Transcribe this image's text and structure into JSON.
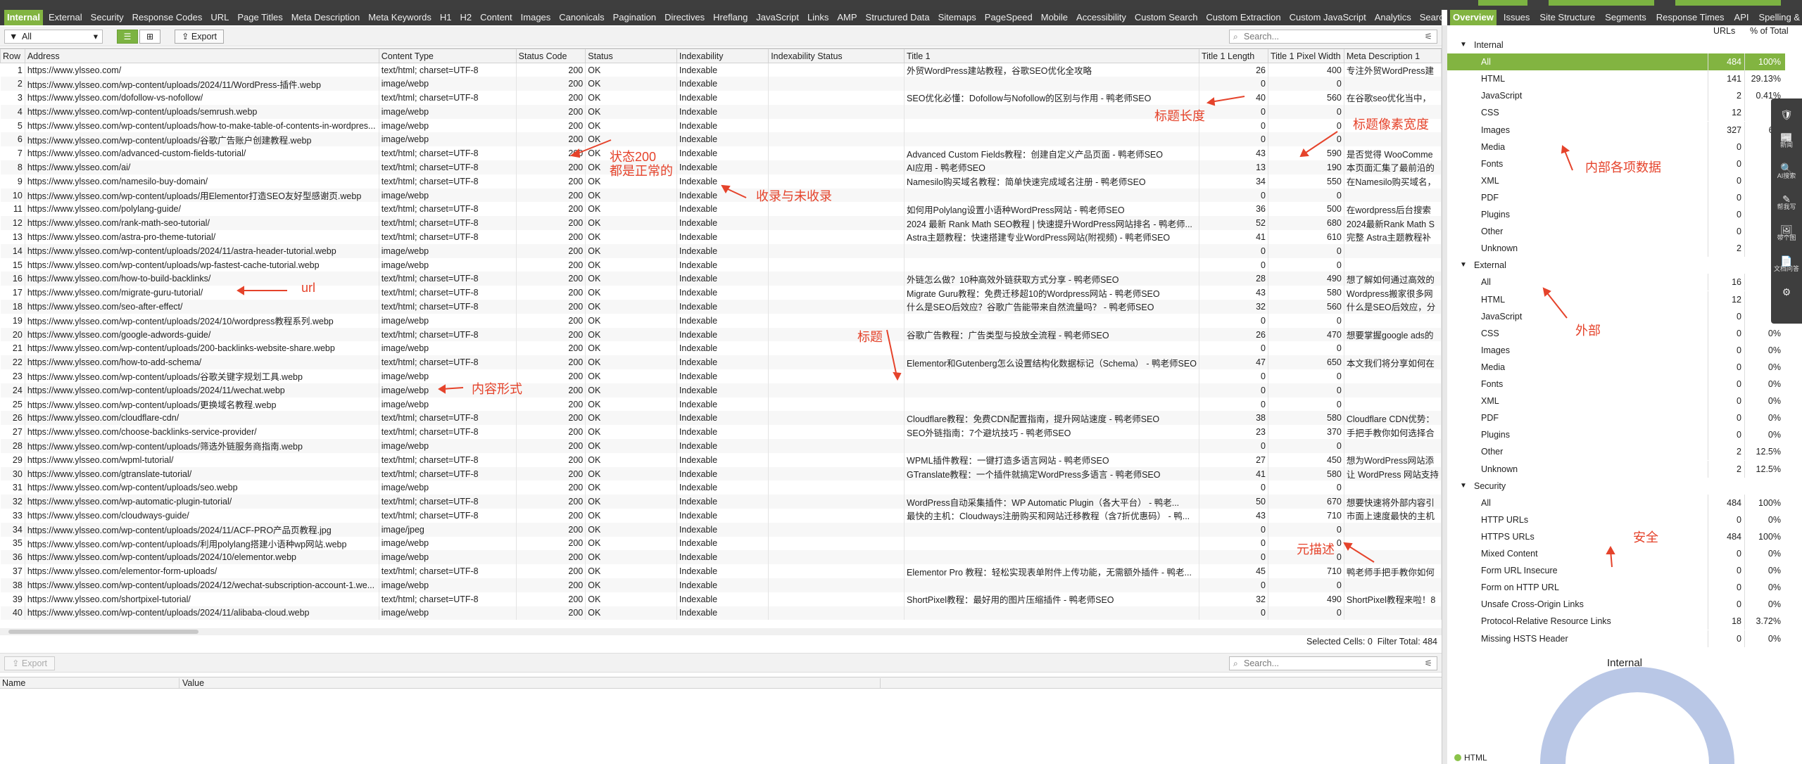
{
  "app": {
    "accent": "#82b441",
    "title": "Screaming Frog SEO Spider"
  },
  "tabs": [
    "Internal",
    "External",
    "Security",
    "Response Codes",
    "URL",
    "Page Titles",
    "Meta Description",
    "Meta Keywords",
    "H1",
    "H2",
    "Content",
    "Images",
    "Canonicals",
    "Pagination",
    "Directives",
    "Hreflang",
    "JavaScript",
    "Links",
    "AMP",
    "Structured Data",
    "Sitemaps",
    "PageSpeed",
    "Mobile",
    "Accessibility",
    "Custom Search",
    "Custom Extraction",
    "Custom JavaScript",
    "Analytics",
    "Search Console",
    "V"
  ],
  "right_tabs": [
    "Overview",
    "Issues",
    "Site Structure",
    "Segments",
    "Response Times",
    "API",
    "Spelling & G"
  ],
  "toolbar": {
    "filter_value": "All",
    "export_label": "Export",
    "search_placeholder": "Search..."
  },
  "columns": [
    "Row",
    "Address",
    "Content Type",
    "Status Code",
    "Status",
    "Indexability",
    "Indexability Status",
    "Title 1",
    "Title 1 Length",
    "Title 1 Pixel Width",
    "Meta Description 1"
  ],
  "rows": [
    [
      "1",
      "https://www.ylsseo.com/",
      "text/html; charset=UTF-8",
      "200",
      "OK",
      "Indexable",
      "",
      "外贸WordPress建站教程，谷歌SEO优化全攻略",
      "26",
      "400",
      "专注外贸WordPress建"
    ],
    [
      "2",
      "https://www.ylsseo.com/wp-content/uploads/2024/11/WordPress-插件.webp",
      "image/webp",
      "200",
      "OK",
      "Indexable",
      "",
      "",
      "0",
      "0",
      ""
    ],
    [
      "3",
      "https://www.ylsseo.com/dofollow-vs-nofollow/",
      "text/html; charset=UTF-8",
      "200",
      "OK",
      "Indexable",
      "",
      "SEO优化必懂：Dofollow与Nofollow的区别与作用 - 鸭老师SEO",
      "40",
      "560",
      "在谷歌seo优化当中，"
    ],
    [
      "4",
      "https://www.ylsseo.com/wp-content/uploads/semrush.webp",
      "image/webp",
      "200",
      "OK",
      "Indexable",
      "",
      "",
      "0",
      "0",
      ""
    ],
    [
      "5",
      "https://www.ylsseo.com/wp-content/uploads/how-to-make-table-of-contents-in-wordpres...",
      "image/webp",
      "200",
      "OK",
      "Indexable",
      "",
      "",
      "0",
      "0",
      ""
    ],
    [
      "6",
      "https://www.ylsseo.com/wp-content/uploads/谷歌广告账户创建教程.webp",
      "image/webp",
      "200",
      "OK",
      "Indexable",
      "",
      "",
      "0",
      "0",
      ""
    ],
    [
      "7",
      "https://www.ylsseo.com/advanced-custom-fields-tutorial/",
      "text/html; charset=UTF-8",
      "200",
      "OK",
      "Indexable",
      "",
      "Advanced Custom Fields教程：创建自定义产品页面 - 鸭老师SEO",
      "43",
      "590",
      "是否觉得 WooComme"
    ],
    [
      "8",
      "https://www.ylsseo.com/ai/",
      "text/html; charset=UTF-8",
      "200",
      "OK",
      "Indexable",
      "",
      "AI应用 - 鸭老师SEO",
      "13",
      "190",
      "本页面汇集了最前沿的"
    ],
    [
      "9",
      "https://www.ylsseo.com/namesilo-buy-domain/",
      "text/html; charset=UTF-8",
      "200",
      "OK",
      "Indexable",
      "",
      "Namesilo购买域名教程：简单快速完成域名注册 - 鸭老师SEO",
      "34",
      "550",
      "在Namesilo购买域名，"
    ],
    [
      "10",
      "https://www.ylsseo.com/wp-content/uploads/用Elementor打造SEO友好型感谢页.webp",
      "image/webp",
      "200",
      "OK",
      "Indexable",
      "",
      "",
      "0",
      "0",
      ""
    ],
    [
      "11",
      "https://www.ylsseo.com/polylang-guide/",
      "text/html; charset=UTF-8",
      "200",
      "OK",
      "Indexable",
      "",
      "如何用Polylang设置小语种WordPress网站 - 鸭老师SEO",
      "36",
      "500",
      "在wordpress后台搜索"
    ],
    [
      "12",
      "https://www.ylsseo.com/rank-math-seo-tutorial/",
      "text/html; charset=UTF-8",
      "200",
      "OK",
      "Indexable",
      "",
      "2024 最新 Rank Math SEO教程 | 快速提升WordPress网站排名 - 鸭老师...",
      "52",
      "680",
      "2024最新Rank Math S"
    ],
    [
      "13",
      "https://www.ylsseo.com/astra-pro-theme-tutorial/",
      "text/html; charset=UTF-8",
      "200",
      "OK",
      "Indexable",
      "",
      "Astra主题教程：快速搭建专业WordPress网站(附视频) - 鸭老师SEO",
      "41",
      "610",
      "完整 Astra主题教程补"
    ],
    [
      "14",
      "https://www.ylsseo.com/wp-content/uploads/2024/11/astra-header-tutorial.webp",
      "image/webp",
      "200",
      "OK",
      "Indexable",
      "",
      "",
      "0",
      "0",
      ""
    ],
    [
      "15",
      "https://www.ylsseo.com/wp-content/uploads/wp-fastest-cache-tutorial.webp",
      "image/webp",
      "200",
      "OK",
      "Indexable",
      "",
      "",
      "0",
      "0",
      ""
    ],
    [
      "16",
      "https://www.ylsseo.com/how-to-build-backlinks/",
      "text/html; charset=UTF-8",
      "200",
      "OK",
      "Indexable",
      "",
      "外链怎么做？10种高效外链获取方式分享 - 鸭老师SEO",
      "28",
      "490",
      "想了解如何通过高效的"
    ],
    [
      "17",
      "https://www.ylsseo.com/migrate-guru-tutorial/",
      "text/html; charset=UTF-8",
      "200",
      "OK",
      "Indexable",
      "",
      "Migrate Guru教程：免费迁移超10的Wordpress网站 - 鸭老师SEO",
      "43",
      "580",
      "Wordpress搬家很多网"
    ],
    [
      "18",
      "https://www.ylsseo.com/seo-after-effect/",
      "text/html; charset=UTF-8",
      "200",
      "OK",
      "Indexable",
      "",
      "什么是SEO后效应？谷歌广告能带来自然流量吗？ - 鸭老师SEO",
      "32",
      "560",
      "什么是SEO后效应，分"
    ],
    [
      "19",
      "https://www.ylsseo.com/wp-content/uploads/2024/10/wordpress教程系列.webp",
      "image/webp",
      "200",
      "OK",
      "Indexable",
      "",
      "",
      "0",
      "0",
      ""
    ],
    [
      "20",
      "https://www.ylsseo.com/google-adwords-guide/",
      "text/html; charset=UTF-8",
      "200",
      "OK",
      "Indexable",
      "",
      "谷歌广告教程：广告类型与投放全流程 - 鸭老师SEO",
      "26",
      "470",
      "想要掌握google ads的"
    ],
    [
      "21",
      "https://www.ylsseo.com/wp-content/uploads/200-backlinks-website-share.webp",
      "image/webp",
      "200",
      "OK",
      "Indexable",
      "",
      "",
      "0",
      "0",
      ""
    ],
    [
      "22",
      "https://www.ylsseo.com/how-to-add-schema/",
      "text/html; charset=UTF-8",
      "200",
      "OK",
      "Indexable",
      "",
      "Elementor和Gutenberg怎么设置结构化数据标记（Schema） - 鸭老师SEO",
      "47",
      "650",
      "本文我们将分享如何在"
    ],
    [
      "23",
      "https://www.ylsseo.com/wp-content/uploads/谷歌关键字规划工具.webp",
      "image/webp",
      "200",
      "OK",
      "Indexable",
      "",
      "",
      "0",
      "0",
      ""
    ],
    [
      "24",
      "https://www.ylsseo.com/wp-content/uploads/2024/11/wechat.webp",
      "image/webp",
      "200",
      "OK",
      "Indexable",
      "",
      "",
      "0",
      "0",
      ""
    ],
    [
      "25",
      "https://www.ylsseo.com/wp-content/uploads/更换域名教程.webp",
      "image/webp",
      "200",
      "OK",
      "Indexable",
      "",
      "",
      "0",
      "0",
      ""
    ],
    [
      "26",
      "https://www.ylsseo.com/cloudflare-cdn/",
      "text/html; charset=UTF-8",
      "200",
      "OK",
      "Indexable",
      "",
      "Cloudflare教程：免费CDN配置指南，提升网站速度 - 鸭老师SEO",
      "38",
      "580",
      "Cloudflare CDN优势："
    ],
    [
      "27",
      "https://www.ylsseo.com/choose-backlinks-service-provider/",
      "text/html; charset=UTF-8",
      "200",
      "OK",
      "Indexable",
      "",
      "SEO外链指南：7个避坑技巧 - 鸭老师SEO",
      "23",
      "370",
      "手把手教你如何选择合"
    ],
    [
      "28",
      "https://www.ylsseo.com/wp-content/uploads/筛选外链服务商指南.webp",
      "image/webp",
      "200",
      "OK",
      "Indexable",
      "",
      "",
      "0",
      "0",
      ""
    ],
    [
      "29",
      "https://www.ylsseo.com/wpml-tutorial/",
      "text/html; charset=UTF-8",
      "200",
      "OK",
      "Indexable",
      "",
      "WPML插件教程：一键打造多语言网站 - 鸭老师SEO",
      "27",
      "450",
      "想为WordPress网站添"
    ],
    [
      "30",
      "https://www.ylsseo.com/gtranslate-tutorial/",
      "text/html; charset=UTF-8",
      "200",
      "OK",
      "Indexable",
      "",
      "GTranslate教程：一个插件就搞定WordPress多语言 - 鸭老师SEO",
      "41",
      "580",
      "让 WordPress 网站支持"
    ],
    [
      "31",
      "https://www.ylsseo.com/wp-content/uploads/seo.webp",
      "image/webp",
      "200",
      "OK",
      "Indexable",
      "",
      "",
      "0",
      "0",
      ""
    ],
    [
      "32",
      "https://www.ylsseo.com/wp-automatic-plugin-tutorial/",
      "text/html; charset=UTF-8",
      "200",
      "OK",
      "Indexable",
      "",
      "WordPress自动采集插件：WP Automatic Plugin（各大平台） - 鸭老...",
      "50",
      "670",
      "想要快速将外部内容引"
    ],
    [
      "33",
      "https://www.ylsseo.com/cloudways-guide/",
      "text/html; charset=UTF-8",
      "200",
      "OK",
      "Indexable",
      "",
      "最快的主机：Cloudways注册购买和网站迁移教程（含7折优惠码） - 鸭...",
      "43",
      "710",
      "市面上速度最快的主机"
    ],
    [
      "34",
      "https://www.ylsseo.com/wp-content/uploads/2024/11/ACF-PRO产品页教程.jpg",
      "image/jpeg",
      "200",
      "OK",
      "Indexable",
      "",
      "",
      "0",
      "0",
      ""
    ],
    [
      "35",
      "https://www.ylsseo.com/wp-content/uploads/利用polylang搭建小语种wp网站.webp",
      "image/webp",
      "200",
      "OK",
      "Indexable",
      "",
      "",
      "0",
      "0",
      ""
    ],
    [
      "36",
      "https://www.ylsseo.com/wp-content/uploads/2024/10/elementor.webp",
      "image/webp",
      "200",
      "OK",
      "Indexable",
      "",
      "",
      "0",
      "0",
      ""
    ],
    [
      "37",
      "https://www.ylsseo.com/elementor-form-uploads/",
      "text/html; charset=UTF-8",
      "200",
      "OK",
      "Indexable",
      "",
      "Elementor Pro 教程：轻松实现表单附件上传功能，无需额外插件 - 鸭老...",
      "45",
      "710",
      "鸭老师手把手教你如何"
    ],
    [
      "38",
      "https://www.ylsseo.com/wp-content/uploads/2024/12/wechat-subscription-account-1.we...",
      "image/webp",
      "200",
      "OK",
      "Indexable",
      "",
      "",
      "0",
      "0",
      ""
    ],
    [
      "39",
      "https://www.ylsseo.com/shortpixel-tutorial/",
      "text/html; charset=UTF-8",
      "200",
      "OK",
      "Indexable",
      "",
      "ShortPixel教程：最好用的图片压缩插件 - 鸭老师SEO",
      "32",
      "490",
      "ShortPixel教程来啦！8"
    ],
    [
      "40",
      "https://www.ylsseo.com/wp-content/uploads/2024/11/alibaba-cloud.webp",
      "image/webp",
      "200",
      "OK",
      "Indexable",
      "",
      "",
      "0",
      "0",
      ""
    ]
  ],
  "status": {
    "selected_cells": "Selected Cells:  0",
    "filter_total": "Filter Total:  484"
  },
  "lower": {
    "export_label": "Export",
    "search_placeholder": "Search...",
    "col_name": "Name",
    "col_value": "Value"
  },
  "right_headers": {
    "urls": "URLs",
    "pct": "% of Total"
  },
  "tree": [
    {
      "k": "sec",
      "label": "Internal"
    },
    {
      "k": "item",
      "label": "All",
      "urls": "484",
      "pct": "100%",
      "hl": true
    },
    {
      "k": "item",
      "label": "HTML",
      "urls": "141",
      "pct": "29.13%"
    },
    {
      "k": "item",
      "label": "JavaScript",
      "urls": "2",
      "pct": "0.41%"
    },
    {
      "k": "item",
      "label": "CSS",
      "urls": "12",
      "pct": "2."
    },
    {
      "k": "item",
      "label": "Images",
      "urls": "327",
      "pct": "67."
    },
    {
      "k": "item",
      "label": "Media",
      "urls": "0",
      "pct": ""
    },
    {
      "k": "item",
      "label": "Fonts",
      "urls": "0",
      "pct": ""
    },
    {
      "k": "item",
      "label": "XML",
      "urls": "0",
      "pct": ""
    },
    {
      "k": "item",
      "label": "PDF",
      "urls": "0",
      "pct": ""
    },
    {
      "k": "item",
      "label": "Plugins",
      "urls": "0",
      "pct": ""
    },
    {
      "k": "item",
      "label": "Other",
      "urls": "0",
      "pct": ""
    },
    {
      "k": "item",
      "label": "Unknown",
      "urls": "2",
      "pct": "0."
    },
    {
      "k": "sec",
      "label": "External"
    },
    {
      "k": "item",
      "label": "All",
      "urls": "16",
      "pct": ""
    },
    {
      "k": "item",
      "label": "HTML",
      "urls": "12",
      "pct": ""
    },
    {
      "k": "item",
      "label": "JavaScript",
      "urls": "0",
      "pct": ""
    },
    {
      "k": "item",
      "label": "CSS",
      "urls": "0",
      "pct": "0%"
    },
    {
      "k": "item",
      "label": "Images",
      "urls": "0",
      "pct": "0%"
    },
    {
      "k": "item",
      "label": "Media",
      "urls": "0",
      "pct": "0%"
    },
    {
      "k": "item",
      "label": "Fonts",
      "urls": "0",
      "pct": "0%"
    },
    {
      "k": "item",
      "label": "XML",
      "urls": "0",
      "pct": "0%"
    },
    {
      "k": "item",
      "label": "PDF",
      "urls": "0",
      "pct": "0%"
    },
    {
      "k": "item",
      "label": "Plugins",
      "urls": "0",
      "pct": "0%"
    },
    {
      "k": "item",
      "label": "Other",
      "urls": "2",
      "pct": "12.5%"
    },
    {
      "k": "item",
      "label": "Unknown",
      "urls": "2",
      "pct": "12.5%"
    },
    {
      "k": "sec",
      "label": "Security"
    },
    {
      "k": "item",
      "label": "All",
      "urls": "484",
      "pct": "100%"
    },
    {
      "k": "item",
      "label": "HTTP URLs",
      "urls": "0",
      "pct": "0%"
    },
    {
      "k": "item",
      "label": "HTTPS URLs",
      "urls": "484",
      "pct": "100%"
    },
    {
      "k": "item",
      "label": "Mixed Content",
      "urls": "0",
      "pct": "0%"
    },
    {
      "k": "item",
      "label": "Form URL Insecure",
      "urls": "0",
      "pct": "0%"
    },
    {
      "k": "item",
      "label": "Form on HTTP URL",
      "urls": "0",
      "pct": "0%"
    },
    {
      "k": "item",
      "label": "Unsafe Cross-Origin Links",
      "urls": "0",
      "pct": "0%"
    },
    {
      "k": "item",
      "label": "Protocol-Relative Resource Links",
      "urls": "18",
      "pct": "3.72%"
    },
    {
      "k": "item",
      "label": "Missing HSTS Header",
      "urls": "0",
      "pct": "0%"
    }
  ],
  "sidenav": [
    "新闻",
    "AI搜索",
    "帮我写",
    "带个图",
    "文档问答"
  ],
  "donut": {
    "title": "Internal",
    "legend": "HTML"
  },
  "annotations": [
    "状态200\n都是正常的",
    "收录与未收录",
    "标题长度",
    "标题像素宽度",
    "内部各项数据",
    "url",
    "外部",
    "标题",
    "内容形式",
    "元描述",
    "安全"
  ],
  "colors": {
    "annotation": "#e5432b",
    "accent": "#82b441"
  }
}
